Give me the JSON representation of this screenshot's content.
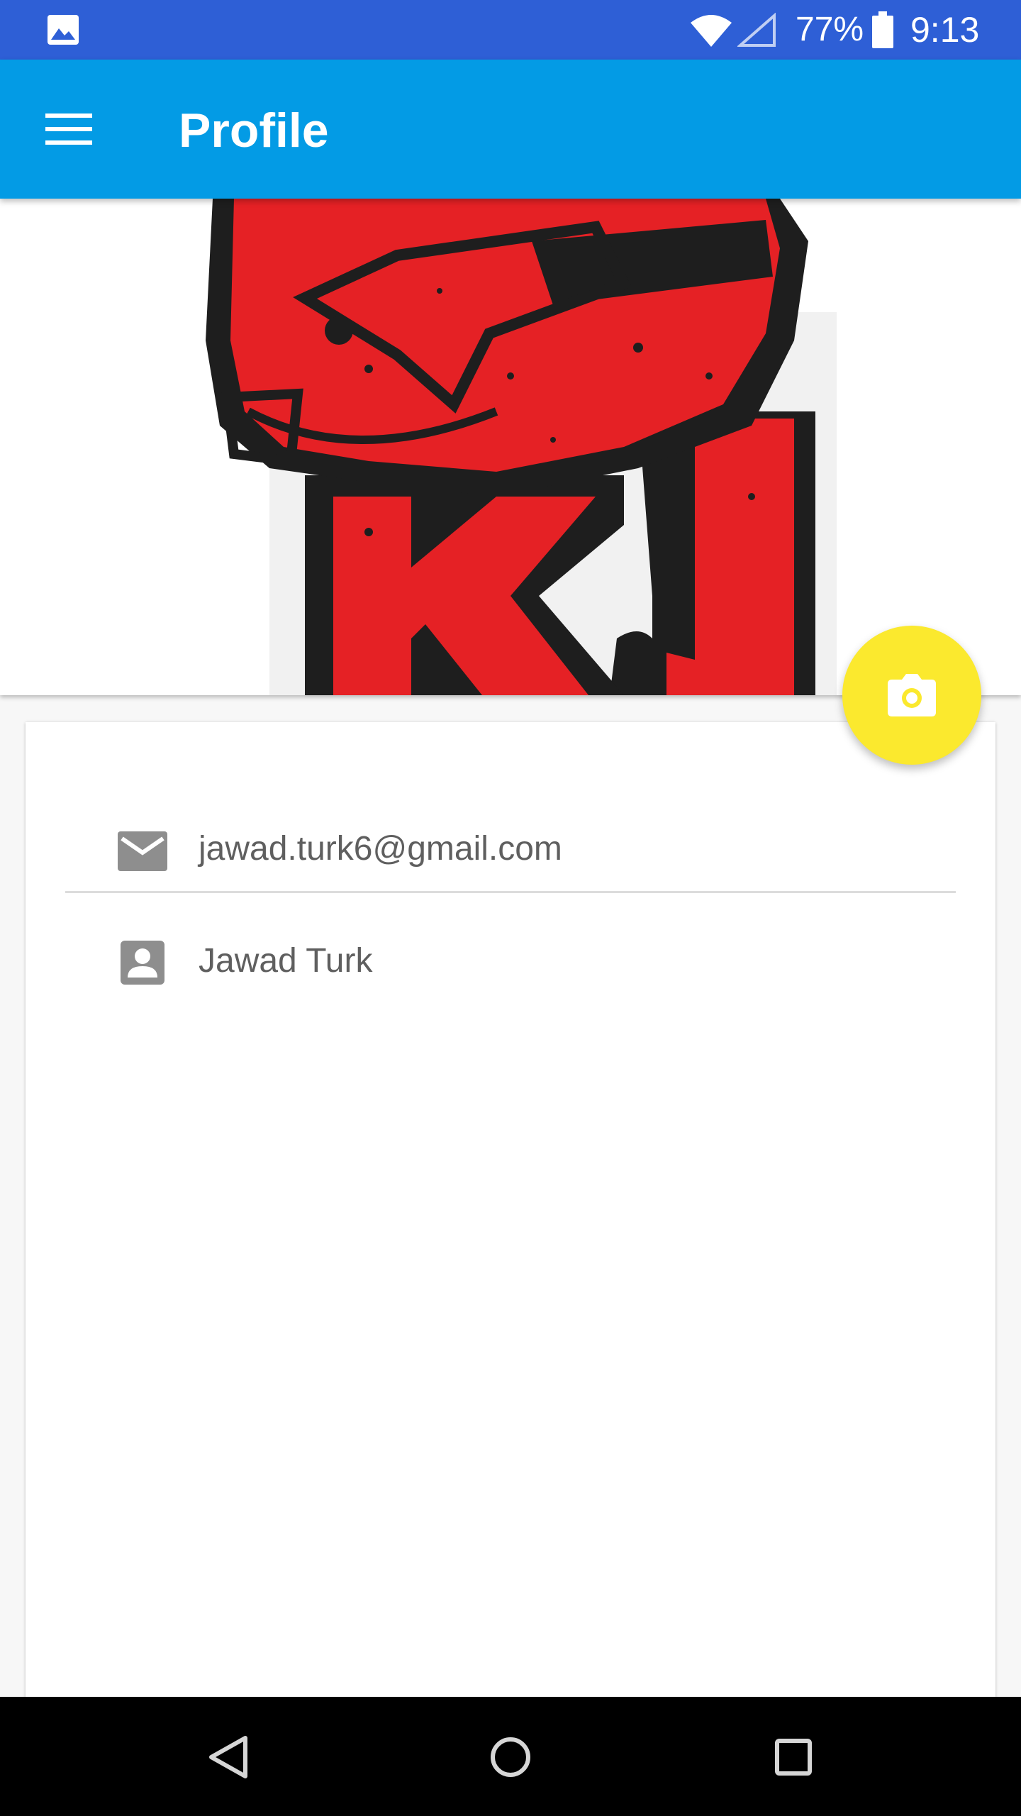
{
  "status_bar": {
    "battery_percent": "77%",
    "time": "9:13",
    "icons": [
      "gallery-icon",
      "wifi-icon",
      "signal-icon",
      "battery-icon"
    ],
    "color": "#2e5fd6"
  },
  "app_bar": {
    "title": "Profile",
    "menu_icon": "hamburger-menu-icon",
    "color": "#039be5"
  },
  "profile": {
    "image": "kj-helmet-logo",
    "email": "jawad.turk6@gmail.com",
    "name": "Jawad Turk",
    "email_icon": "mail-icon",
    "name_icon": "account-box-icon"
  },
  "fab": {
    "icon": "camera-icon",
    "color": "#fbe92e"
  },
  "nav_bar": {
    "buttons": [
      "back-icon",
      "home-icon",
      "recents-icon"
    ]
  }
}
